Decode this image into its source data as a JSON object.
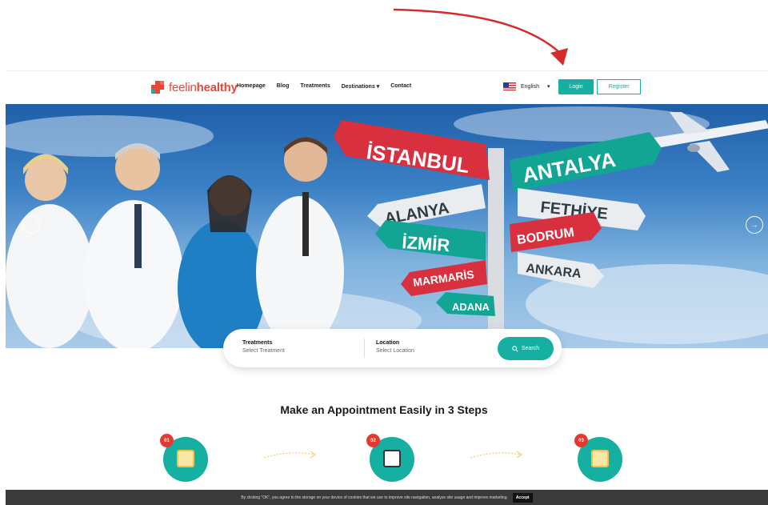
{
  "header": {
    "logo_text_a": "feelin",
    "logo_text_b": "healthy",
    "nav": [
      "Homepage",
      "Blog",
      "Treatments",
      "Destinations",
      "Contact"
    ],
    "language": "English",
    "login": "Login",
    "register": "Register"
  },
  "hero": {
    "signs_left": [
      "İSTANBUL",
      "ALANYA",
      "İZMİR",
      "MARMARİS",
      "ADANA"
    ],
    "signs_right": [
      "ANTALYA",
      "FETHİYE",
      "BODRUM",
      "ANKARA"
    ]
  },
  "search": {
    "treatments_label": "Treatments",
    "treatments_placeholder": "Select Treatment",
    "location_label": "Location",
    "location_placeholder": "Select Location",
    "button": "Search"
  },
  "steps": {
    "title": "Make an Appointment Easily in 3 Steps",
    "items": [
      {
        "num": "01"
      },
      {
        "num": "02"
      },
      {
        "num": "03"
      }
    ]
  },
  "cookie": {
    "text": "By clicking \"OK\", you agree to the storage on your device of cookies that we use to improve site navigation, analyze site usage and improve marketing.",
    "accept": "Accept"
  },
  "colors": {
    "accent": "#16b0a2",
    "brand_red": "#e8473a",
    "annotation_red": "#d62b2b"
  }
}
